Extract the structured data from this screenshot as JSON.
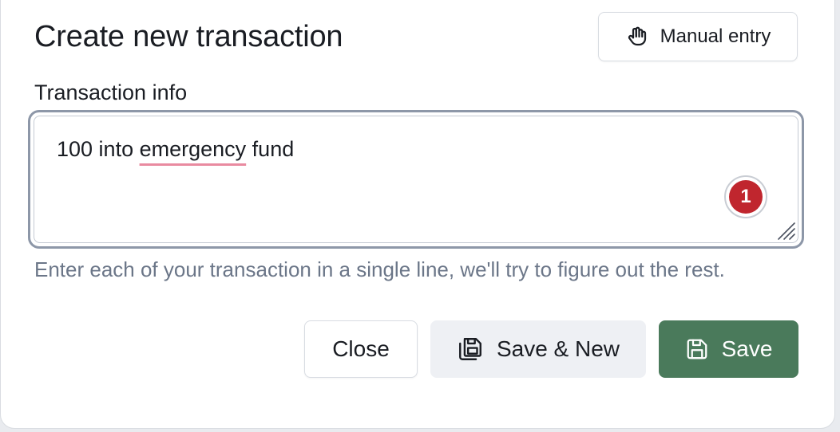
{
  "modal": {
    "title": "Create new transaction",
    "manual_entry_label": "Manual entry",
    "manual_entry_icon": "hand-icon"
  },
  "form": {
    "field_label": "Transaction info",
    "value_before": "100 into ",
    "value_misspelled": "emergency",
    "value_after": " fund",
    "badge_count": "1",
    "helper_text": "Enter each of your transaction in a single line, we'll try to figure out the rest."
  },
  "actions": {
    "close_label": "Close",
    "save_new_label": "Save & New",
    "save_new_icon": "save-multiple-icon",
    "save_label": "Save",
    "save_icon": "save-icon"
  },
  "colors": {
    "primary": "#4a7a5b",
    "badge": "#c0262e",
    "focus_ring": "#8d97a8",
    "helper_text": "#6b7688"
  }
}
